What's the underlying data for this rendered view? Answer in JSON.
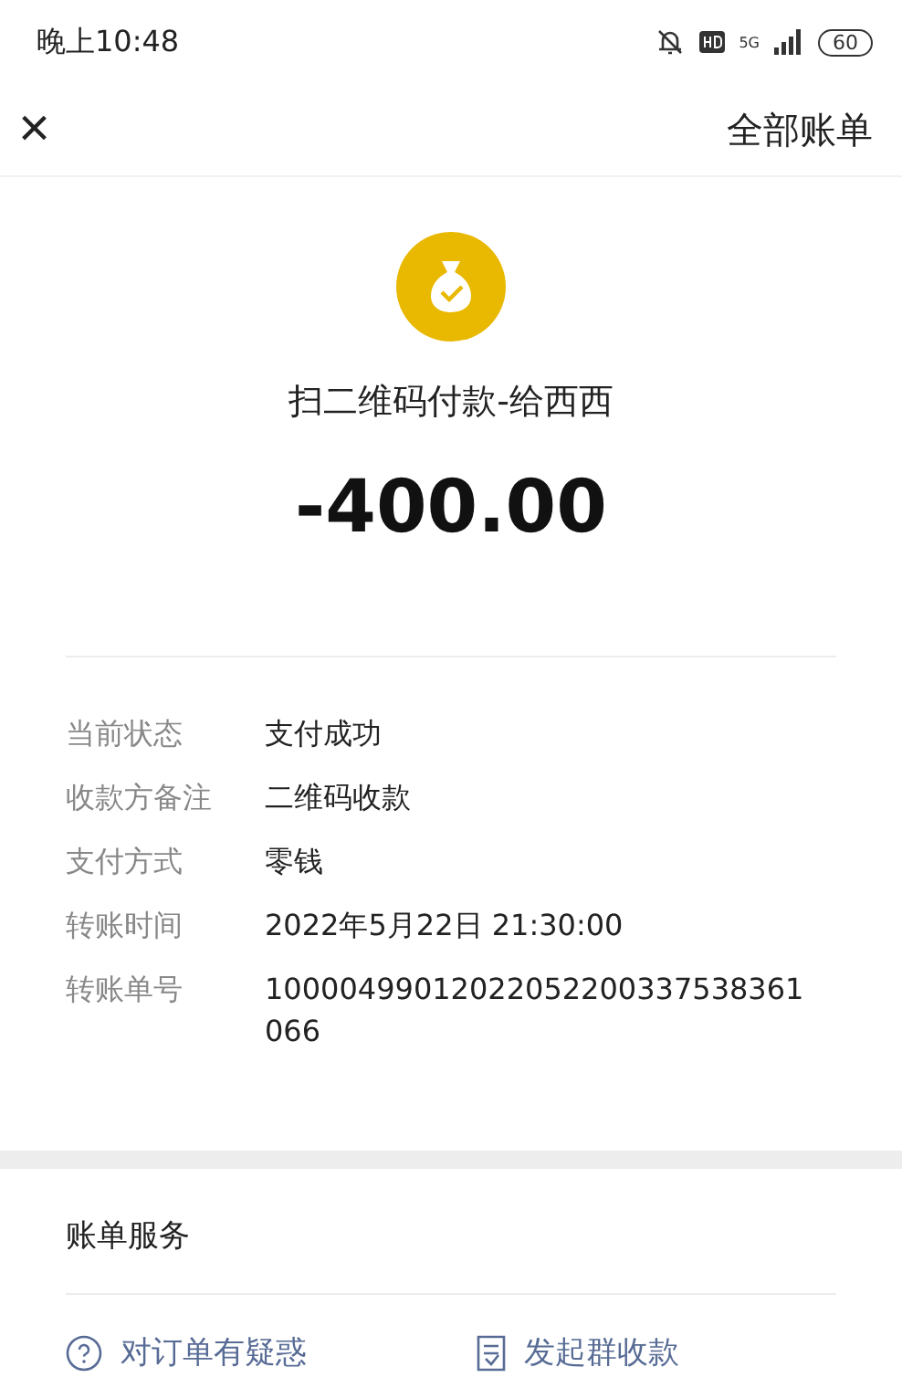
{
  "status_bar": {
    "time": "晚上10:48",
    "network": "5G",
    "battery": "60"
  },
  "header": {
    "close": "×",
    "link": "全部账单"
  },
  "payment": {
    "title": "扫二维码付款-给西西",
    "amount": "-400.00"
  },
  "details": [
    {
      "label": "当前状态",
      "value": "支付成功"
    },
    {
      "label": "收款方备注",
      "value": "二维码收款"
    },
    {
      "label": "支付方式",
      "value": "零钱"
    },
    {
      "label": "转账时间",
      "value": "2022年5月22日 21:30:00"
    },
    {
      "label": "转账单号",
      "value": "10000499012022052200337538361066"
    }
  ],
  "services": {
    "title": "账单服务",
    "actions": [
      {
        "kind": "question",
        "label": "对订单有疑惑"
      },
      {
        "kind": "group",
        "label": "发起群收款"
      }
    ]
  }
}
